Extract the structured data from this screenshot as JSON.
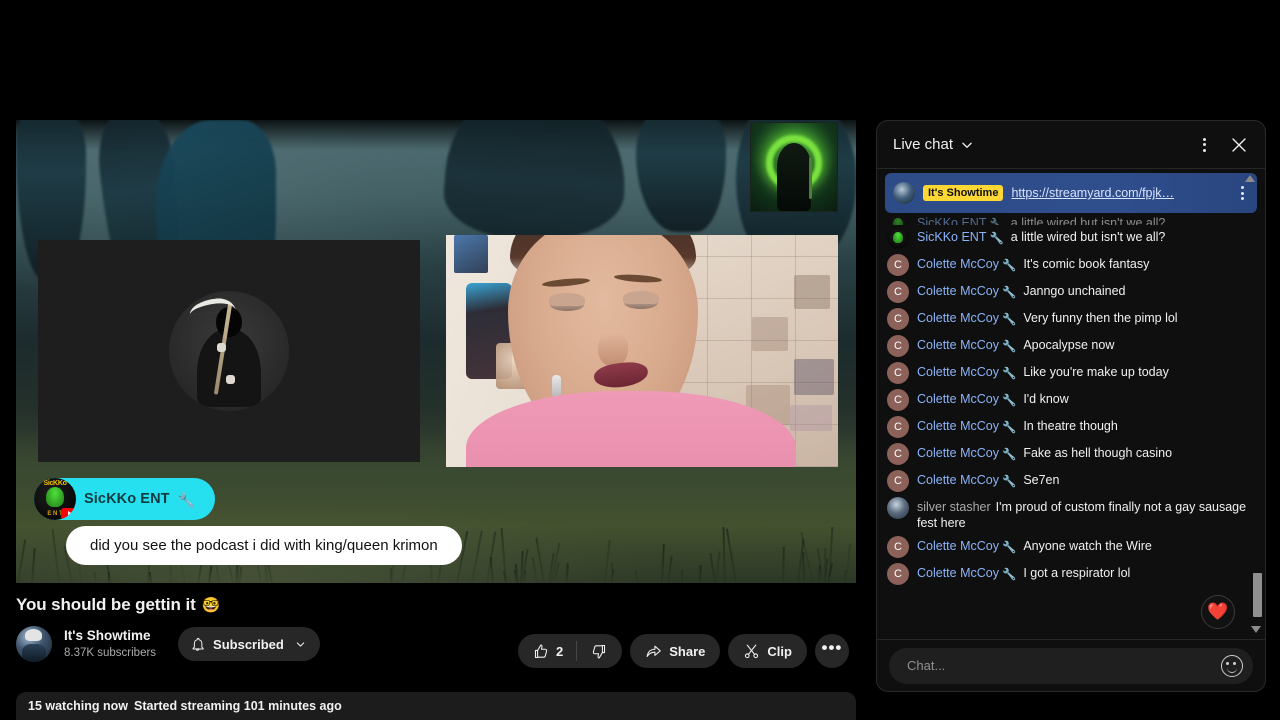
{
  "player": {
    "nameplate": {
      "label": "SicKKo ENT",
      "badge_icon": "wrench-icon"
    },
    "speech_bubble": {
      "text": "did you see the podcast i did with king/queen krimon"
    }
  },
  "meta": {
    "title": "You should be gettin it",
    "title_emoji": "🤓",
    "channel_name": "It's Showtime",
    "subscribers": "8.37K subscribers",
    "subscribe_label": "Subscribed"
  },
  "actions": {
    "like_count": "2",
    "share_label": "Share",
    "clip_label": "Clip",
    "more_label": "•••"
  },
  "status": {
    "watching": "15 watching now",
    "started": "Started streaming 101 minutes ago"
  },
  "chat": {
    "title": "Live chat",
    "pinned": {
      "author_badge": "It's Showtime",
      "link": "https://streamyard.com/fpjk…"
    },
    "input_placeholder": "Chat...",
    "heart_emoji": "❤️",
    "messages": [
      {
        "author": "SicKKo ENT",
        "avatar": "sickko",
        "badge": "wrench-icon",
        "text": "a little wired but isn't we all?",
        "clipped": true
      },
      {
        "author": "SicKKo ENT",
        "avatar": "sickko",
        "badge": "wrench-icon",
        "text": "a little wired but isn't we all?"
      },
      {
        "author": "Colette McCoy",
        "avatar": "c",
        "badge": "wrench-icon",
        "text": "It's comic book fantasy"
      },
      {
        "author": "Colette McCoy",
        "avatar": "c",
        "badge": "wrench-icon",
        "text": "Janngo unchained"
      },
      {
        "author": "Colette McCoy",
        "avatar": "c",
        "badge": "wrench-icon",
        "text": "Very funny then the pimp lol"
      },
      {
        "author": "Colette McCoy",
        "avatar": "c",
        "badge": "wrench-icon",
        "text": "Apocalypse now"
      },
      {
        "author": "Colette McCoy",
        "avatar": "c",
        "badge": "wrench-icon",
        "text": "Like you're make up today"
      },
      {
        "author": "Colette McCoy",
        "avatar": "c",
        "badge": "wrench-icon",
        "text": "I'd know"
      },
      {
        "author": "Colette McCoy",
        "avatar": "c",
        "badge": "wrench-icon",
        "text": "In theatre though"
      },
      {
        "author": "Colette McCoy",
        "avatar": "c",
        "badge": "wrench-icon",
        "text": "Fake as hell though casino"
      },
      {
        "author": "Colette McCoy",
        "avatar": "c",
        "badge": "wrench-icon",
        "text": "Se7en"
      },
      {
        "author": "silver stasher",
        "avatar": "silver",
        "badge": "",
        "text": "I'm proud of custom finally not a gay sausage fest here"
      },
      {
        "author": "Colette McCoy",
        "avatar": "c",
        "badge": "wrench-icon",
        "text": "Anyone watch the Wire"
      },
      {
        "author": "Colette McCoy",
        "avatar": "c",
        "badge": "wrench-icon",
        "text": "I got a respirator lol"
      }
    ]
  },
  "colors": {
    "accent_blue": "#8ab4f8",
    "pinned_blue": "#2d4b87",
    "badge_yellow": "#fdd835",
    "nameplate_cyan": "#26e0ef",
    "youtube_red": "#ff0000"
  }
}
